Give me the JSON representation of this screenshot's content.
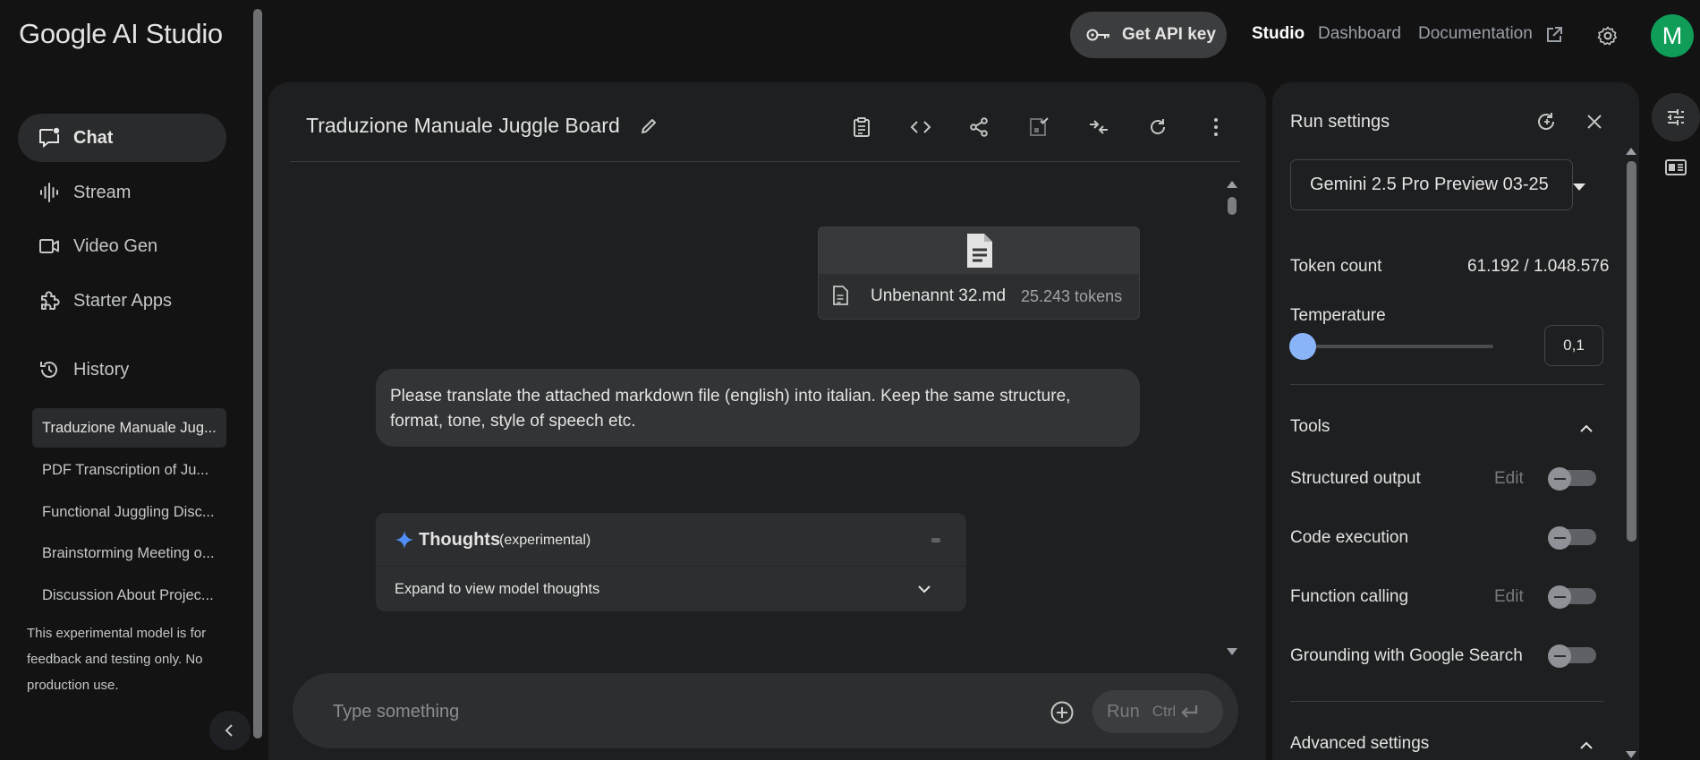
{
  "app": {
    "title": "Google AI Studio"
  },
  "topbar": {
    "get_api_key": "Get API key",
    "links": {
      "studio": "Studio",
      "dashboard": "Dashboard",
      "documentation": "Documentation"
    },
    "avatar_initial": "M"
  },
  "sidebar": {
    "nav": [
      {
        "label": "Chat",
        "icon": "chat-icon",
        "active": true
      },
      {
        "label": "Stream",
        "icon": "waveform-icon"
      },
      {
        "label": "Video Gen",
        "icon": "video-icon"
      },
      {
        "label": "Starter Apps",
        "icon": "puzzle-icon"
      },
      {
        "label": "History",
        "icon": "history-icon"
      }
    ],
    "history": [
      "Traduzione Manuale Jug...",
      "PDF Transcription of Ju...",
      "Functional Juggling Disc...",
      "Brainstorming Meeting o...",
      "Discussion About Projec..."
    ],
    "note": "This experimental model is for feedback and testing only. No production use."
  },
  "chat": {
    "title": "Traduzione Manuale Juggle Board",
    "attachment": {
      "filename": "Unbenannt 32.md",
      "tokens": "25.243 tokens"
    },
    "user_message": "Please translate the attached markdown file (english) into italian. Keep the same structure, format, tone, style of speech etc.",
    "thoughts": {
      "title": "Thoughts",
      "subtitle": "(experimental)",
      "expand_label": "Expand to view model thoughts"
    },
    "input_placeholder": "Type something",
    "run_label": "Run",
    "run_shortcut": "Ctrl"
  },
  "run_settings": {
    "title": "Run settings",
    "model": "Gemini 2.5 Pro Preview 03-25",
    "token_count_label": "Token count",
    "token_count_value": "61.192 / 1.048.576",
    "temperature_label": "Temperature",
    "temperature_value": "0,1",
    "temperature_level": 0.1,
    "tools_label": "Tools",
    "tools": [
      {
        "label": "Structured output",
        "edit": "Edit",
        "enabled": false
      },
      {
        "label": "Code execution",
        "enabled": false
      },
      {
        "label": "Function calling",
        "edit": "Edit",
        "enabled": false
      },
      {
        "label": "Grounding with Google Search",
        "enabled": false
      }
    ],
    "advanced_label": "Advanced settings"
  },
  "colors": {
    "accent": "#8ab4f8",
    "avatar": "#0f9d58",
    "background": "#131314",
    "panel": "#1e1f20"
  }
}
